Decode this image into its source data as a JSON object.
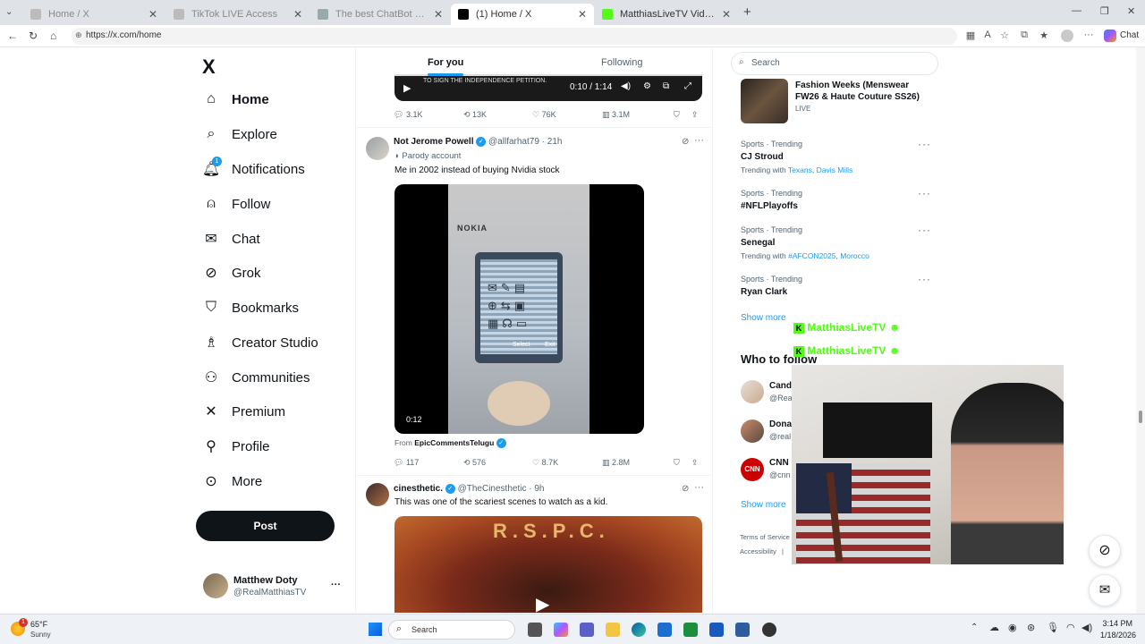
{
  "browser": {
    "tabs": [
      {
        "label": "Home / X",
        "active": false
      },
      {
        "label": "TikTok LIVE Access",
        "active": false
      },
      {
        "label": "The best ChatBot and Widgets for",
        "active": false
      },
      {
        "label": "(1) Home / X",
        "active": true
      },
      {
        "label": "MatthiasLiveTV Videos - Watch On",
        "active": false
      }
    ],
    "new_tab": "+",
    "url": "https://x.com/home",
    "chat_label": "Chat"
  },
  "nav": {
    "logo": "X",
    "items": [
      {
        "label": "Home",
        "icon": "home-icon",
        "active": true
      },
      {
        "label": "Explore",
        "icon": "search-icon"
      },
      {
        "label": "Notifications",
        "icon": "bell-icon",
        "badge": "1"
      },
      {
        "label": "Follow",
        "icon": "person-add-icon"
      },
      {
        "label": "Chat",
        "icon": "mail-icon"
      },
      {
        "label": "Grok",
        "icon": "grok-icon"
      },
      {
        "label": "Bookmarks",
        "icon": "bookmark-icon"
      },
      {
        "label": "Creator Studio",
        "icon": "creator-icon"
      },
      {
        "label": "Communities",
        "icon": "communities-icon"
      },
      {
        "label": "Premium",
        "icon": "x-icon"
      },
      {
        "label": "Profile",
        "icon": "profile-icon"
      },
      {
        "label": "More",
        "icon": "more-icon"
      }
    ],
    "post_button": "Post",
    "account": {
      "name": "Matthew Doty",
      "handle": "@RealMatthiasTV",
      "menu": "···"
    }
  },
  "feed": {
    "tabs": [
      {
        "label": "For you",
        "active": true
      },
      {
        "label": "Following",
        "active": false
      }
    ],
    "top_post": {
      "video_caption": "TO SIGN THE INDEPENDENCE PETITION.",
      "video_time": "0:10 / 1:14",
      "stats": {
        "replies": "3.1K",
        "reposts": "13K",
        "likes": "76K",
        "views": "3.1M"
      }
    },
    "post1": {
      "name": "Not Jerome Powell",
      "handle": "@allfarhat79",
      "time": "· 21h",
      "badge": "Parody account",
      "text": "Me in 2002 instead of buying Nvidia stock",
      "video_duration": "0:12",
      "phone_brand": "NOKIA",
      "phone_softkey_left": "Select",
      "phone_softkey_right": "Exit",
      "from_label": "From",
      "from_source": "EpicCommentsTelugu",
      "stats": {
        "replies": "117",
        "reposts": "576",
        "likes": "8.7K",
        "views": "2.8M"
      }
    },
    "post2": {
      "name": "cinesthetic.",
      "handle": "@TheCinesthetic",
      "time": "· 9h",
      "text": "This was one of the scariest scenes to watch as a kid.",
      "video_banner": "R.S.P.C."
    }
  },
  "sidebar": {
    "search_placeholder": "Search",
    "live_event": {
      "title": "Fashion Weeks (Menswear FW26 & Haute Couture SS26)",
      "status": "LIVE"
    },
    "trends": [
      {
        "category": "Sports · Trending",
        "name": "CJ Stroud",
        "sub_prefix": "Trending with",
        "links": [
          "Texans",
          "Davis Mills"
        ]
      },
      {
        "category": "Sports · Trending",
        "name": "#NFLPlayoffs"
      },
      {
        "category": "Sports · Trending",
        "name": "Senegal",
        "sub_prefix": "Trending with",
        "links": [
          "#AFCON2025",
          "Morocco"
        ]
      },
      {
        "category": "Sports · Trending",
        "name": "Ryan Clark"
      }
    ],
    "show_more": "Show more",
    "who_to_follow": {
      "title": "Who to follow",
      "accounts": [
        {
          "name": "Cand",
          "handle": "@Rea"
        },
        {
          "name": "Dona",
          "handle": "@real"
        },
        {
          "name": "CNN",
          "handle": "@cnn"
        }
      ],
      "show_more": "Show more"
    },
    "footer": {
      "terms": "Terms of Service",
      "accessibility": "Accessibility",
      "sep": "|"
    }
  },
  "overlay": {
    "stream_banner": "MatthiasLiveTV"
  },
  "taskbar": {
    "weather_temp": "65°F",
    "weather_desc": "Sunny",
    "weather_badge": "1",
    "search": "Search",
    "time": "3:14 PM",
    "date": "1/18/2026"
  }
}
